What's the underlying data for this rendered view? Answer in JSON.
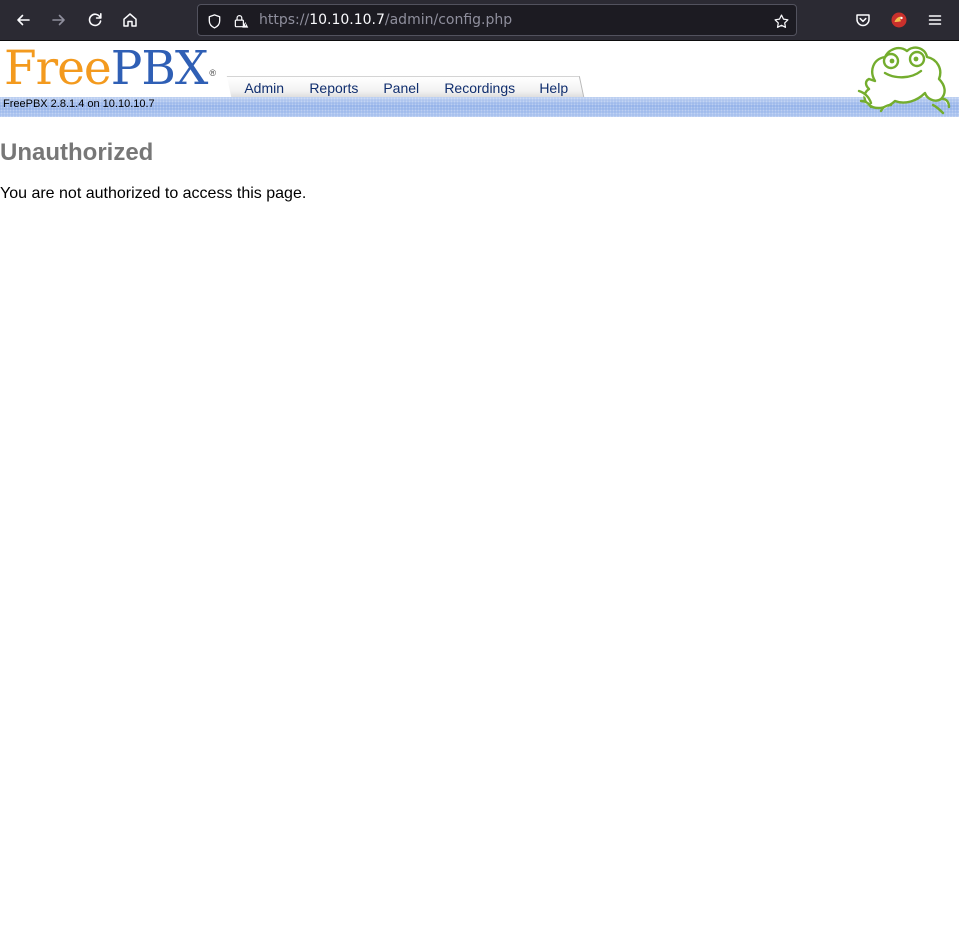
{
  "browser": {
    "url_scheme": "https://",
    "url_host": "10.10.10.7",
    "url_path": "/admin/config.php"
  },
  "header": {
    "logo_free": "Free",
    "logo_pbx": "PBX",
    "logo_mark": "®",
    "version_text": "FreePBX 2.8.1.4 on 10.10.10.7",
    "nav": [
      {
        "label": "Admin"
      },
      {
        "label": "Reports"
      },
      {
        "label": "Panel"
      },
      {
        "label": "Recordings"
      },
      {
        "label": "Help"
      }
    ]
  },
  "main": {
    "title": "Unauthorized",
    "message": "You are not authorized to access this page."
  },
  "colors": {
    "chrome_bg": "#2b2a33",
    "url_bg": "#1c1b22",
    "logo_orange": "#f39a1e",
    "logo_blue": "#2f5fb5",
    "title_gray": "#777777"
  }
}
